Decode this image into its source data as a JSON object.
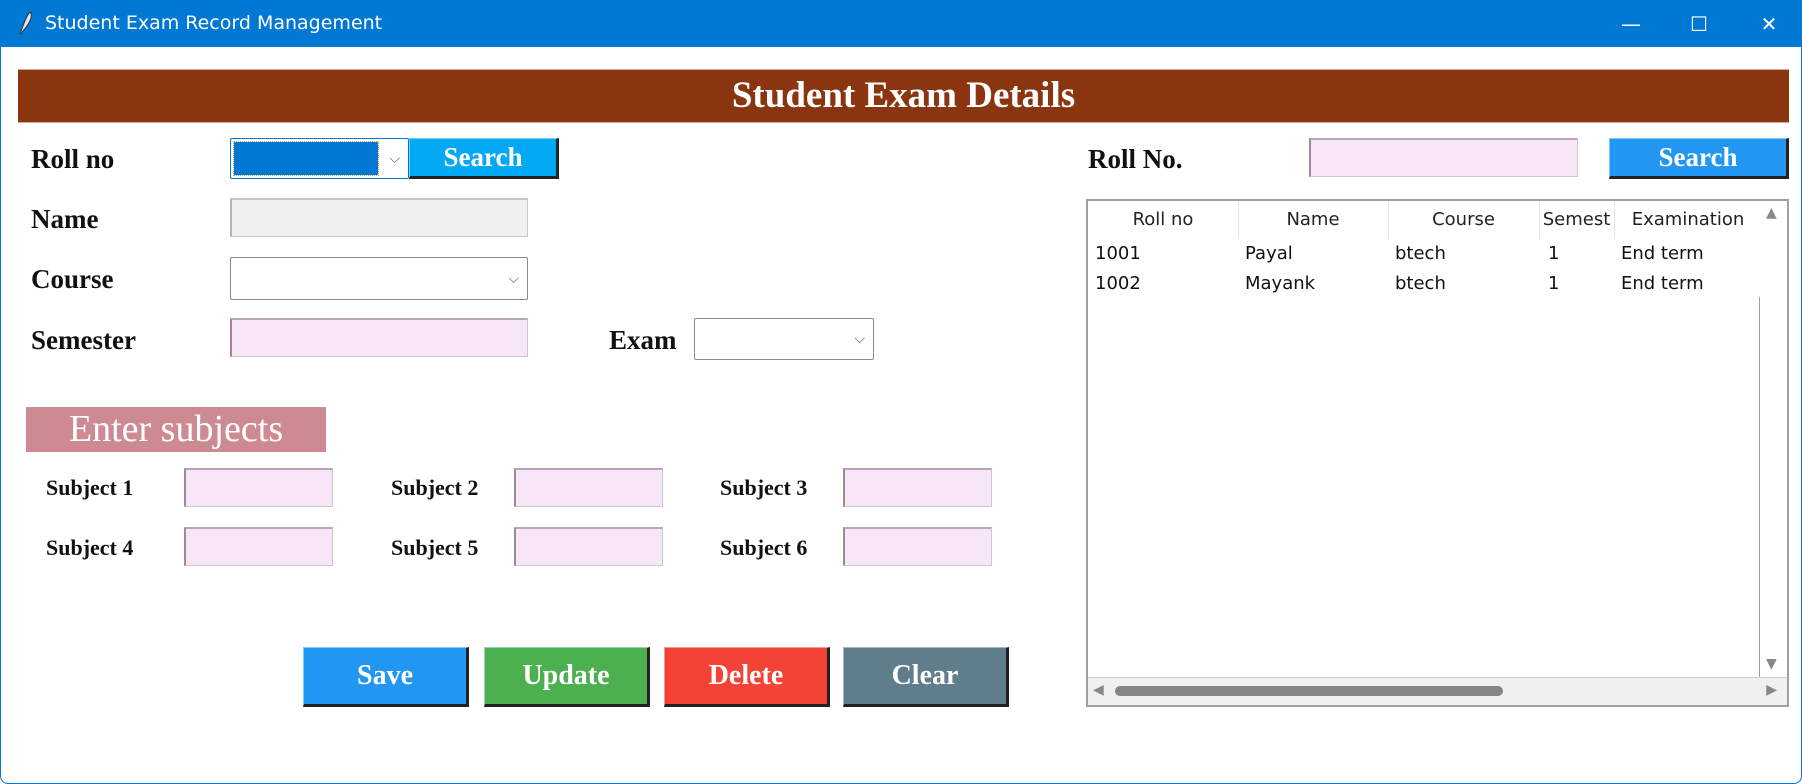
{
  "window": {
    "title": "Student Exam Record Management",
    "icon": "feather-icon",
    "controls": {
      "minimize": "—",
      "maximize": "☐",
      "close": "✕"
    }
  },
  "banner": {
    "title": "Student Exam Details"
  },
  "form": {
    "roll_no_label": "Roll no",
    "roll_no_value": "",
    "search_label": "Search",
    "name_label": "Name",
    "name_value": "",
    "course_label": "Course",
    "course_value": "",
    "semester_label": "Semester",
    "semester_value": "",
    "exam_label": "Exam",
    "exam_value": ""
  },
  "subjects": {
    "heading": "Enter subjects",
    "items": [
      {
        "label": "Subject 1",
        "value": ""
      },
      {
        "label": "Subject 2",
        "value": ""
      },
      {
        "label": "Subject 3",
        "value": ""
      },
      {
        "label": "Subject 4",
        "value": ""
      },
      {
        "label": "Subject 5",
        "value": ""
      },
      {
        "label": "Subject 6",
        "value": ""
      }
    ]
  },
  "actions": {
    "save": "Save",
    "update": "Update",
    "delete": "Delete",
    "clear": "Clear"
  },
  "colors": {
    "titlebar": "#0078d4",
    "banner": "#8b3510",
    "subjects_banner": "#cd8a93",
    "search_left": "#03a9f4",
    "search_right": "#2196f3",
    "save": "#2196f3",
    "update": "#4caf50",
    "delete": "#f44336",
    "clear": "#607d8b",
    "entry_bg": "#f8e6f8"
  },
  "right_panel": {
    "roll_no_label": "Roll No.",
    "roll_no_value": "",
    "search_label": "Search",
    "table": {
      "columns": [
        "Roll no",
        "Name",
        "Course",
        "Semest",
        "Examination"
      ],
      "rows": [
        [
          "1001",
          "Payal",
          "btech",
          "1",
          "End term"
        ],
        [
          "1002",
          "Mayank",
          "btech",
          "1",
          "End term"
        ]
      ]
    }
  }
}
